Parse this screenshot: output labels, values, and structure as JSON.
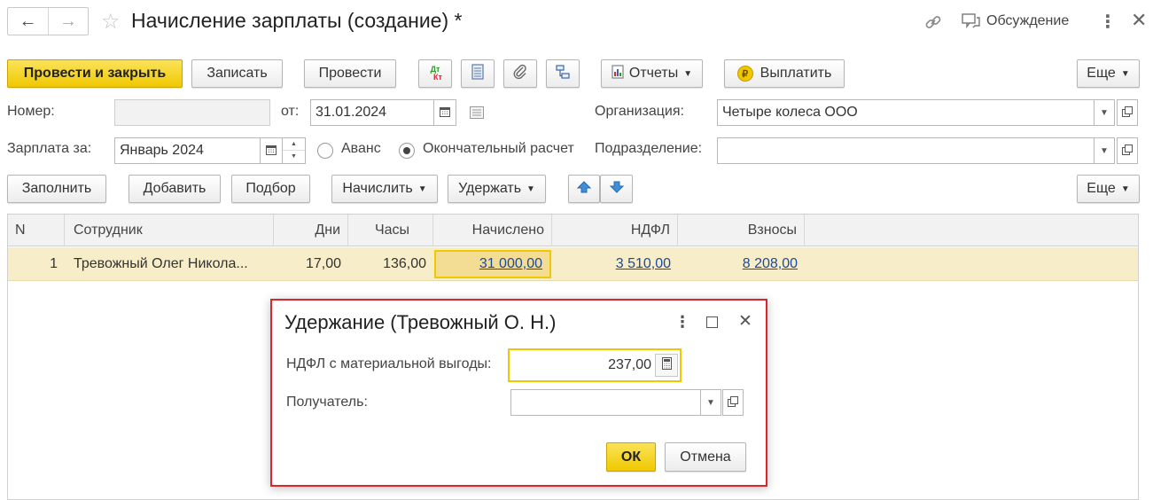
{
  "header": {
    "title": "Начисление зарплаты (создание) *",
    "discussion_label": "Обсуждение"
  },
  "toolbar": {
    "post_close": "Провести и закрыть",
    "save": "Записать",
    "post": "Провести",
    "dtkt_top": "Дт",
    "dtkt_bottom": "Кт",
    "reports": "Отчеты",
    "pay": "Выплатить",
    "more": "Еще"
  },
  "form": {
    "number_label": "Номер:",
    "number_value": "",
    "date_label": "от:",
    "date_value": "31.01.2024",
    "org_label": "Организация:",
    "org_value": "Четыре колеса ООО",
    "salary_for_label": "Зарплата за:",
    "salary_for_value": "Январь 2024",
    "advance_label": "Аванс",
    "final_label": "Окончательный расчет",
    "dept_label": "Подразделение:",
    "dept_value": ""
  },
  "table_toolbar": {
    "fill": "Заполнить",
    "add": "Добавить",
    "pick": "Подбор",
    "accrue": "Начислить",
    "withhold": "Удержать",
    "more": "Еще"
  },
  "table": {
    "columns": [
      "N",
      "Сотрудник",
      "Дни",
      "Часы",
      "Начислено",
      "НДФЛ",
      "Взносы"
    ],
    "rows": [
      {
        "n": "1",
        "employee": "Тревожный Олег Никола...",
        "days": "17,00",
        "hours": "136,00",
        "accrued": "31 000,00",
        "ndfl": "3 510,00",
        "contributions": "8 208,00"
      }
    ]
  },
  "dialog": {
    "title": "Удержание (Тревожный О. Н.)",
    "ndfl_label": "НДФЛ с материальной выгоды:",
    "ndfl_value": "237,00",
    "recipient_label": "Получатель:",
    "recipient_value": "",
    "ok": "ОК",
    "cancel": "Отмена"
  },
  "colors": {
    "accent_yellow": "#f0c800",
    "selected_row": "#f7edc8",
    "link_blue": "#1c4a9c",
    "highlight_red": "#d9262f"
  }
}
